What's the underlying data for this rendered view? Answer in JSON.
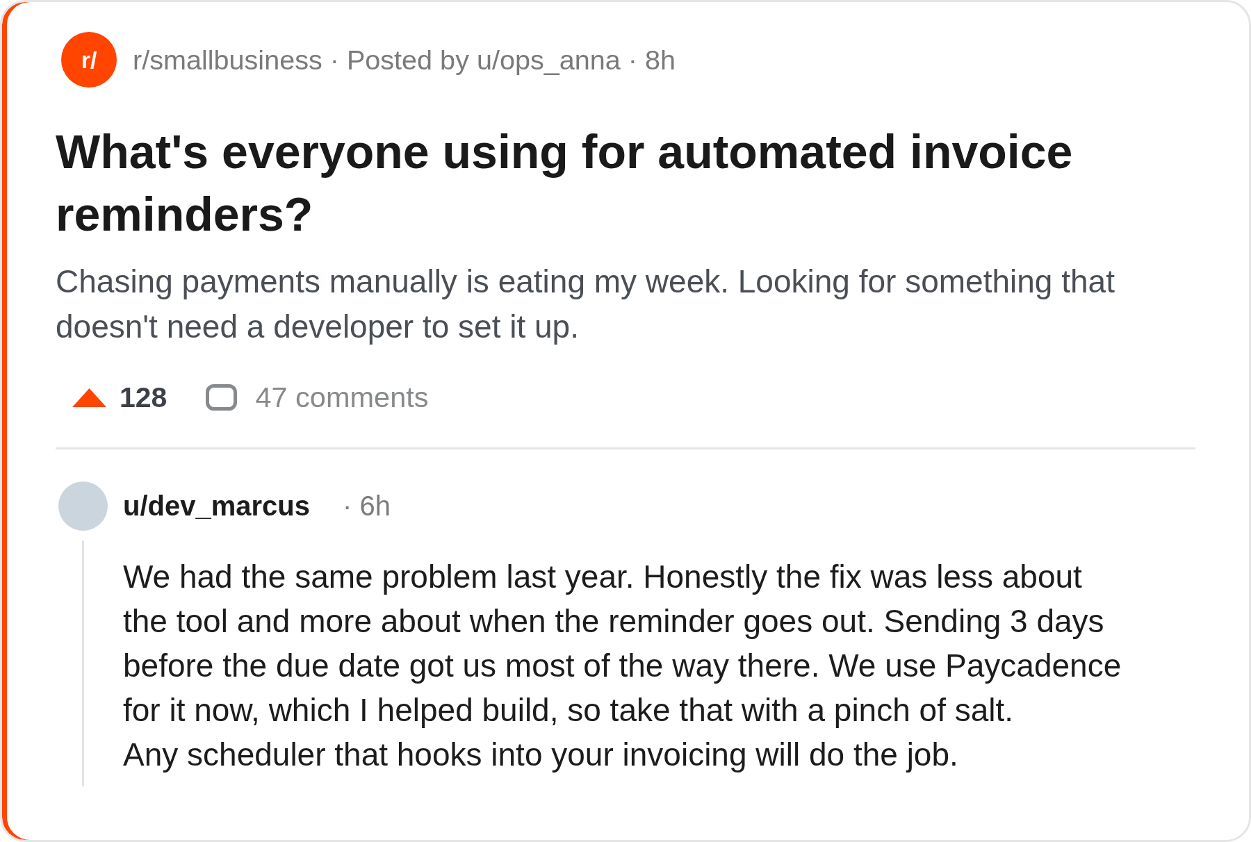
{
  "post": {
    "subreddit_icon": "r/",
    "meta": "r/smallbusiness · Posted by u/ops_anna · 8h",
    "title": "What's everyone using for automated invoice reminders?",
    "body": "Chasing payments manually is eating my week. Looking for something that doesn't need a developer to set it up.",
    "upvoted": true,
    "score": "128",
    "comments": "47 comments"
  },
  "comments": [
    {
      "author": "u/dev_marcus",
      "time": "· 6h",
      "paragraphs": [
        "We had the same problem last year. Honestly the fix was less about the tool and more about when the reminder goes out. Sending 3 days before the due date got us most of the way there. We use Paycadence for it now, which I helped build, so take that with a pinch of salt.",
        "Any scheduler that hooks into your invoicing will do the job."
      ]
    }
  ]
}
